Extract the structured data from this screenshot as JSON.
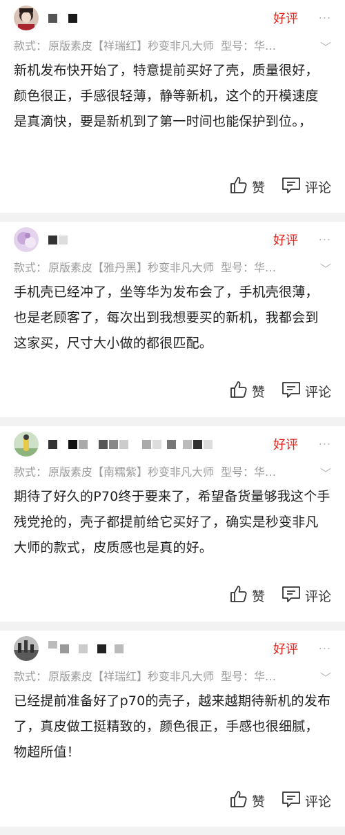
{
  "labels": {
    "spec_prefix": "款式：",
    "model_text": "型号：华…",
    "more_glyph": "···",
    "chevron_glyph": "﹀",
    "like": "赞",
    "comment": "评论"
  },
  "reviews": [
    {
      "user_name_masked": "■ ■",
      "rating": "好评",
      "spec_value": "原版素皮【祥瑞红】秒变非凡大师",
      "text": "新机发布快开始了，特意提前买好了壳，质量很好，颜色很正，手感很轻薄，静等新机，这个的开模速度是真滴快，要是新机到了第一时间也能保护到位。，"
    },
    {
      "user_name_masked": "■ ■",
      "rating": "好评",
      "spec_value": "原版素皮【雅丹黑】秒变非凡大师",
      "text": "手机壳已经冲了，坐等华为发布会了，手机壳很薄，也是老顾客了，每次出到我想要买的新机，我都会到这家买，尺寸大小做的都很匹配。"
    },
    {
      "user_name_masked": "■ ■ ■ ■",
      "rating": "好评",
      "spec_value": "原版素皮【南糯紫】秒变非凡大师",
      "text": "期待了好久的P70终于要来了，希望备货量够我这个手残党抢的，壳子都提前给它买好了，确实是秒变非凡大师的款式，皮质感也是真的好。"
    },
    {
      "user_name_masked": "■ ■ ■ ■",
      "rating": "好评",
      "spec_value": "原版素皮【祥瑞红】秒变非凡大师",
      "text": "已经提前准备好了p70的壳子，越来越期待新机的发布了，真皮做工挺精致的，颜色很正，手感也很细腻，物超所值！"
    }
  ]
}
